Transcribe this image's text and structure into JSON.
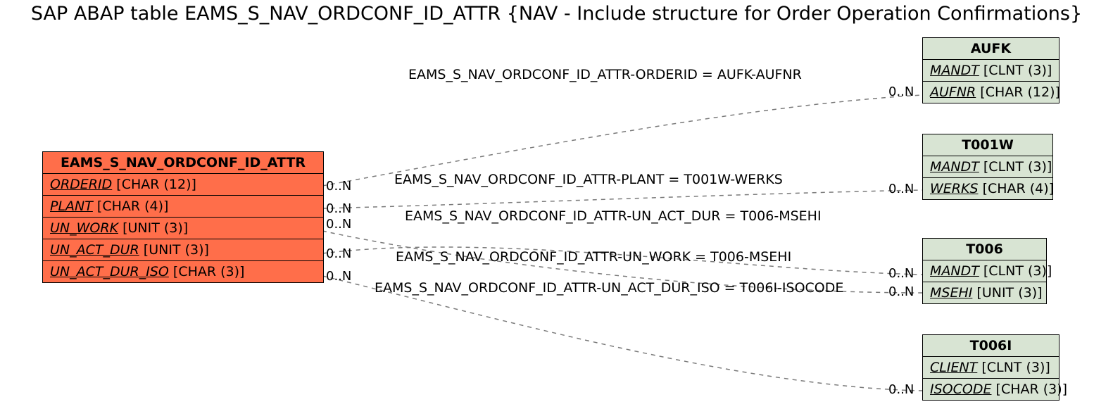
{
  "title": "SAP ABAP table EAMS_S_NAV_ORDCONF_ID_ATTR {NAV - Include structure for Order Operation Confirmations}",
  "source": {
    "name": "EAMS_S_NAV_ORDCONF_ID_ATTR",
    "fields": [
      {
        "name": "ORDERID",
        "type": "[CHAR (12)]"
      },
      {
        "name": "PLANT",
        "type": "[CHAR (4)]"
      },
      {
        "name": "UN_WORK",
        "type": "[UNIT (3)]"
      },
      {
        "name": "UN_ACT_DUR",
        "type": "[UNIT (3)]"
      },
      {
        "name": "UN_ACT_DUR_ISO",
        "type": "[CHAR (3)]"
      }
    ]
  },
  "targets": {
    "aufk": {
      "name": "AUFK",
      "fields": [
        {
          "name": "MANDT",
          "type": "[CLNT (3)]"
        },
        {
          "name": "AUFNR",
          "type": "[CHAR (12)]"
        }
      ]
    },
    "t001w": {
      "name": "T001W",
      "fields": [
        {
          "name": "MANDT",
          "type": "[CLNT (3)]"
        },
        {
          "name": "WERKS",
          "type": "[CHAR (4)]"
        }
      ]
    },
    "t006": {
      "name": "T006",
      "fields": [
        {
          "name": "MANDT",
          "type": "[CLNT (3)]"
        },
        {
          "name": "MSEHI",
          "type": "[UNIT (3)]"
        }
      ]
    },
    "t006i": {
      "name": "T006I",
      "fields": [
        {
          "name": "CLIENT",
          "type": "[CLNT (3)]"
        },
        {
          "name": "ISOCODE",
          "type": "[CHAR (3)]"
        }
      ]
    }
  },
  "relations": [
    {
      "label": "EAMS_S_NAV_ORDCONF_ID_ATTR-ORDERID = AUFK-AUFNR",
      "left_card": "0..N",
      "right_card": "0..N"
    },
    {
      "label": "EAMS_S_NAV_ORDCONF_ID_ATTR-PLANT = T001W-WERKS",
      "left_card": "0..N",
      "right_card": "0..N"
    },
    {
      "label": "EAMS_S_NAV_ORDCONF_ID_ATTR-UN_ACT_DUR = T006-MSEHI",
      "left_card": "0..N",
      "right_card": "0..N"
    },
    {
      "label": "EAMS_S_NAV_ORDCONF_ID_ATTR-UN_WORK = T006-MSEHI",
      "left_card": "0..N",
      "right_card": "0..N"
    },
    {
      "label": "EAMS_S_NAV_ORDCONF_ID_ATTR-UN_ACT_DUR_ISO = T006I-ISOCODE",
      "left_card": "0..N",
      "right_card": "0..N"
    }
  ]
}
